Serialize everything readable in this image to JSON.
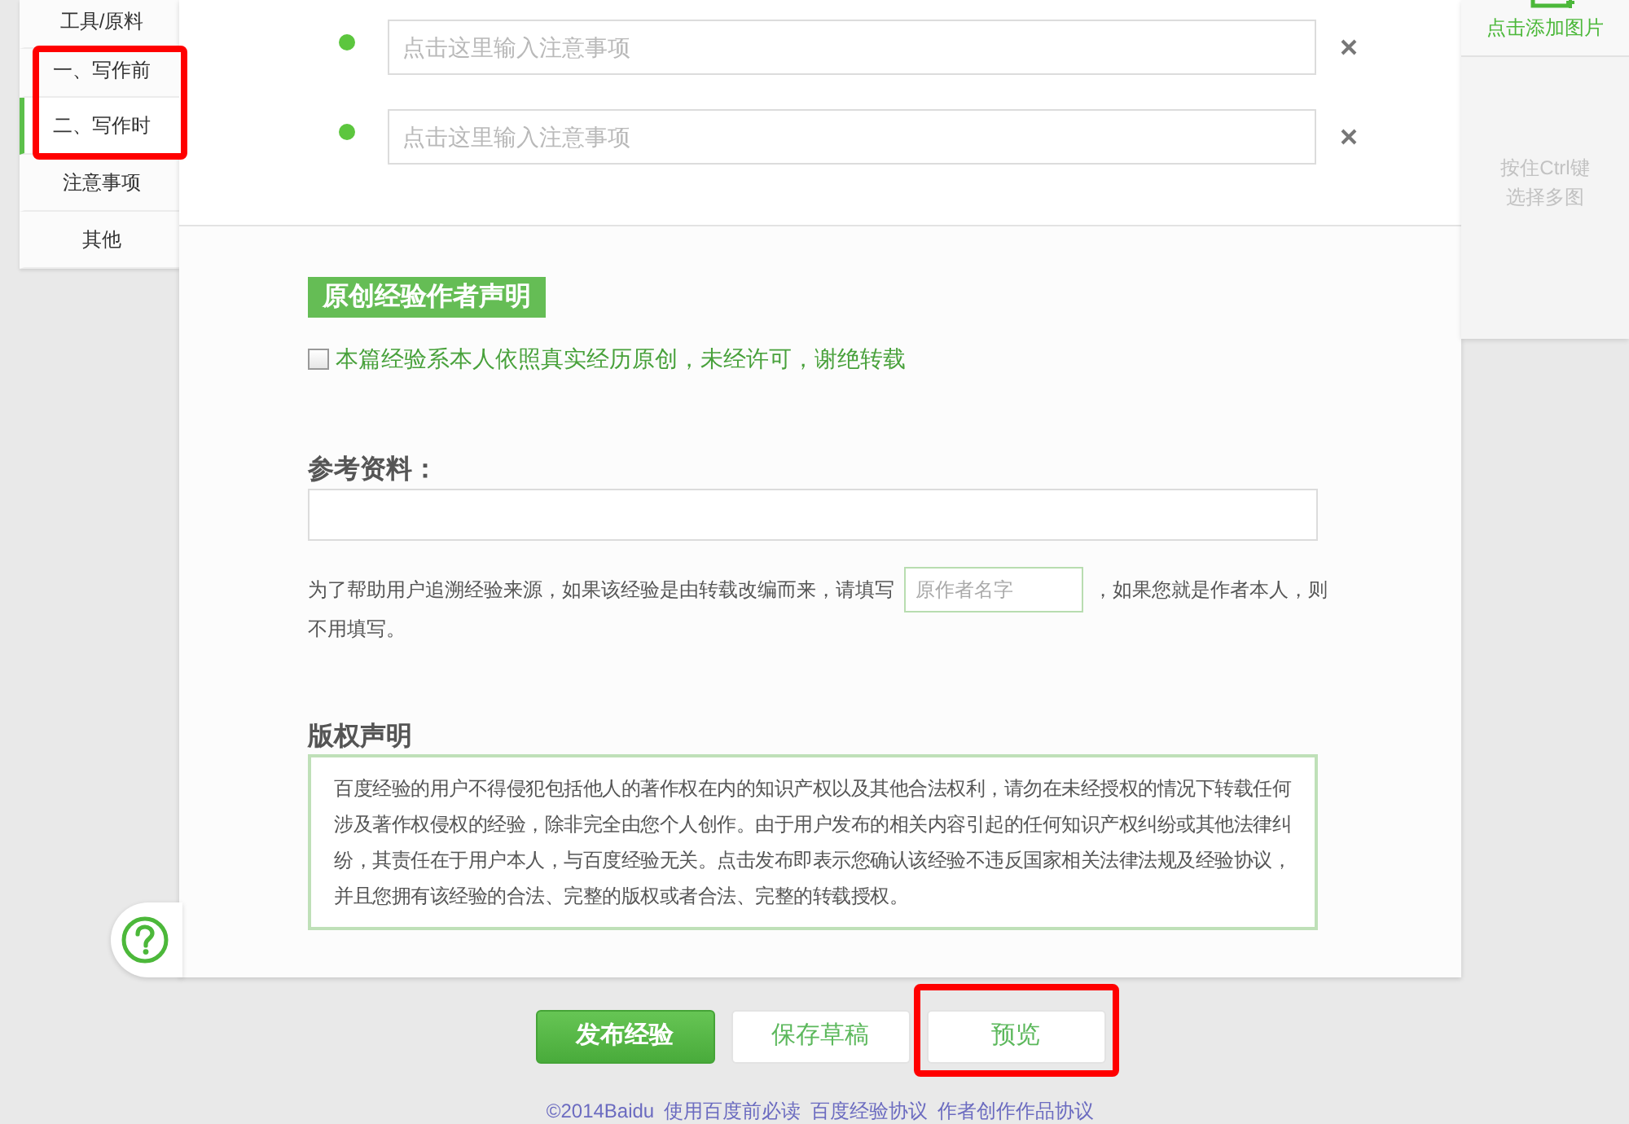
{
  "sidebar": {
    "items": [
      {
        "label": "工具/原料",
        "selected": false,
        "highlighted": false
      },
      {
        "label": "一、写作前",
        "selected": false,
        "highlighted": true
      },
      {
        "label": "二、写作时",
        "selected": true,
        "highlighted": true
      },
      {
        "label": "注意事项",
        "selected": false,
        "highlighted": false
      },
      {
        "label": "其他",
        "selected": false,
        "highlighted": false
      }
    ]
  },
  "notes": [
    {
      "placeholder": "点击这里输入注意事项"
    },
    {
      "placeholder": "点击这里输入注意事项"
    }
  ],
  "image_panel": {
    "add_label": "点击添加图片",
    "hint_lines": [
      "按住Ctrl键",
      "选择多图"
    ]
  },
  "originality": {
    "badge": "原创经验作者声明",
    "statement": "本篇经验系本人依照真实经历原创，未经许可，谢绝转载",
    "checked": false
  },
  "references": {
    "heading": "参考资料：",
    "help_before": "为了帮助用户追溯经验来源，如果该经验是由转载改编而来，请填写",
    "author_field": {
      "placeholder": "原作者名字"
    },
    "help_after": "，如果您就是作者本人，则",
    "help_end": "不用填写。"
  },
  "copyright": {
    "heading": "版权声明",
    "text": "百度经验的用户不得侵犯包括他人的著作权在内的知识产权以及其他合法权利，请勿在未经授权的情况下转载任何涉及著作权侵权的经验，除非完全由您个人创作。由于用户发布的相关内容引起的任何知识产权纠纷或其他法律纠纷，其责任在于用户本人，与百度经验无关。点击发布即表示您确认该经验不违反国家相关法律法规及经验协议，并且您拥有该经验的合法、完整的版权或者合法、完整的转载授权。"
  },
  "actions": [
    {
      "label": "发布经验",
      "kind": "primary",
      "highlighted": false
    },
    {
      "label": "保存草稿",
      "kind": "secondary",
      "highlighted": false
    },
    {
      "label": "预览",
      "kind": "secondary",
      "highlighted": true
    }
  ],
  "footer": {
    "copyright": "©2014Baidu",
    "links": [
      "使用百度前必读",
      "百度经验协议",
      "作者创作作品协议"
    ]
  }
}
